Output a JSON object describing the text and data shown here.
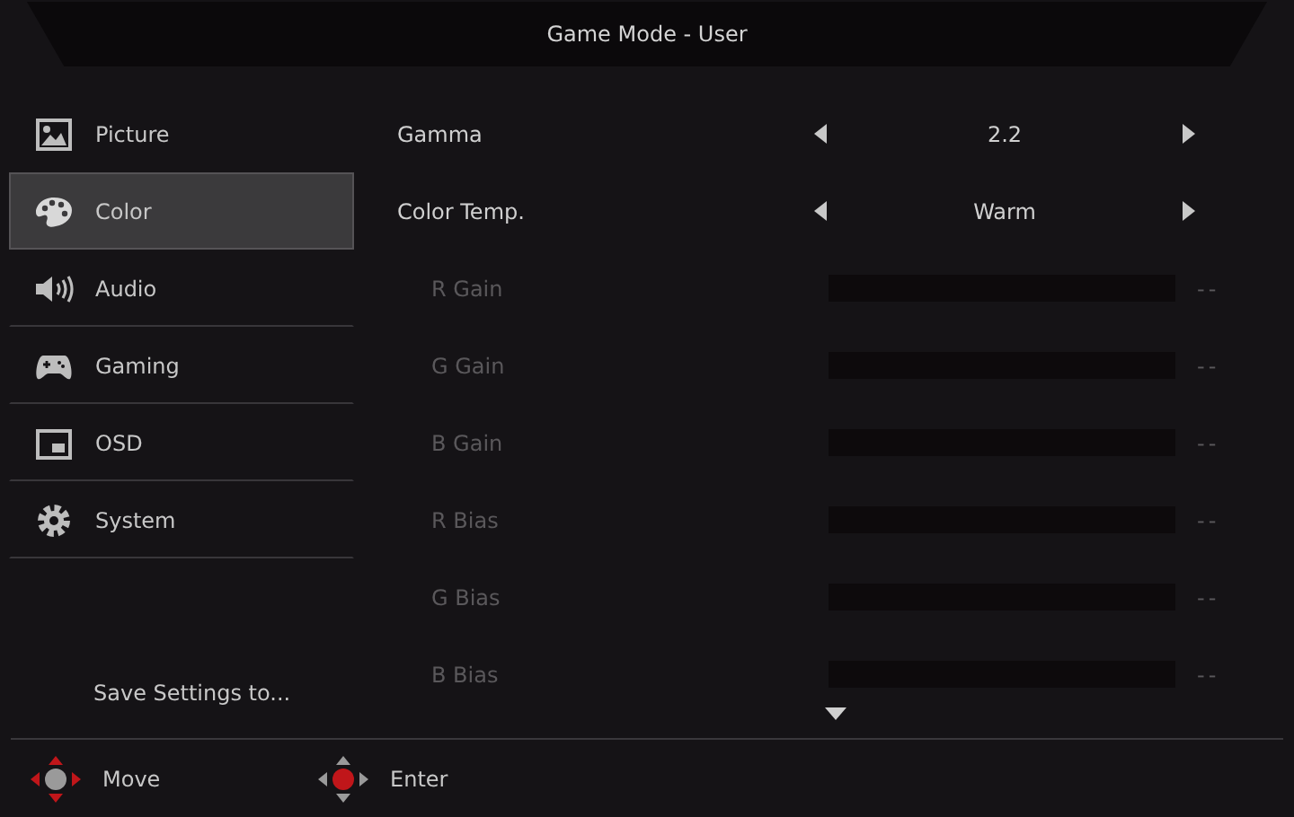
{
  "header": {
    "title": "Game Mode - User"
  },
  "sidebar": {
    "items": [
      {
        "kind": "picture",
        "label": "Picture",
        "selected": false
      },
      {
        "kind": "color",
        "label": "Color",
        "selected": true
      },
      {
        "kind": "audio",
        "label": "Audio",
        "selected": false
      },
      {
        "kind": "gaming",
        "label": "Gaming",
        "selected": false
      },
      {
        "kind": "osd",
        "label": "OSD",
        "selected": false
      },
      {
        "kind": "system",
        "label": "System",
        "selected": false
      }
    ],
    "save_label": "Save Settings to..."
  },
  "settings": {
    "rows": [
      {
        "kind": "choice",
        "label": "Gamma",
        "value": "2.2",
        "disabled": false
      },
      {
        "kind": "choice",
        "label": "Color Temp.",
        "value": "Warm",
        "disabled": false
      },
      {
        "kind": "slider",
        "label": "R Gain",
        "reading": "--",
        "disabled": true
      },
      {
        "kind": "slider",
        "label": "G Gain",
        "reading": "--",
        "disabled": true
      },
      {
        "kind": "slider",
        "label": "B Gain",
        "reading": "--",
        "disabled": true
      },
      {
        "kind": "slider",
        "label": "R Bias",
        "reading": "--",
        "disabled": true
      },
      {
        "kind": "slider",
        "label": "G Bias",
        "reading": "--",
        "disabled": true
      },
      {
        "kind": "slider",
        "label": "B Bias",
        "reading": "--",
        "disabled": true
      }
    ],
    "more_below": true
  },
  "footer": {
    "hints": [
      {
        "kind": "move",
        "label": "Move"
      },
      {
        "kind": "enter",
        "label": "Enter"
      }
    ]
  }
}
